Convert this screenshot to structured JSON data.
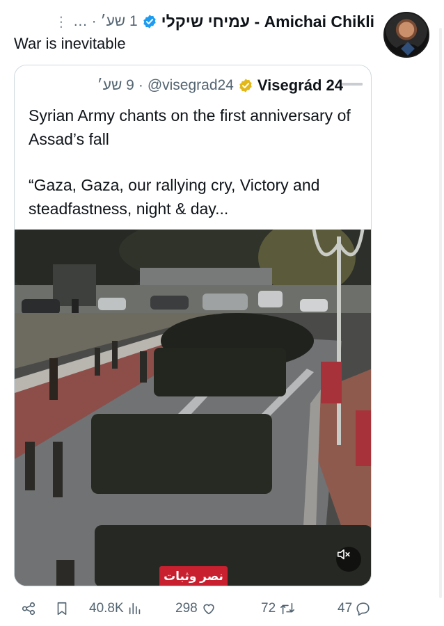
{
  "author": {
    "name": "עמיחי שיקלי - Amichai Chikli",
    "time": "1 שע׳",
    "more_label": "…"
  },
  "tweet": {
    "text": "War is inevitable"
  },
  "quoted": {
    "name": "Visegrád 24",
    "handle": "@visegrad24",
    "separator": "·",
    "time": "9 שע׳",
    "text_line1": "Syrian Army chants on the first anniversary of Assad’s fall",
    "text_line2": "“Gaza, Gaza, our rallying cry, Victory and steadfastness, night & day...",
    "video_banner": "نصر وثبات",
    "video_muted": true
  },
  "actions": {
    "views": "40.8K",
    "likes": "298",
    "reposts": "72",
    "replies": "47"
  },
  "colors": {
    "text": "#0f1419",
    "secondary": "#536471",
    "verified_blue": "#1d9bf0",
    "verified_gold": "#e2b719",
    "border": "#cfd9de",
    "banner_red": "#c8202f"
  },
  "icons": [
    "more-icon",
    "verified-blue-icon",
    "verified-gold-icon",
    "share-icon",
    "bookmark-icon",
    "views-icon",
    "like-icon",
    "repost-icon",
    "reply-icon",
    "mute-icon"
  ]
}
